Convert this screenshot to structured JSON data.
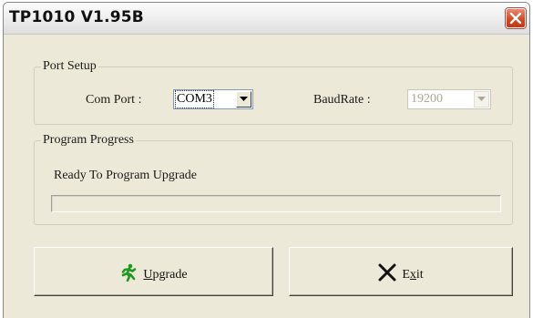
{
  "window": {
    "title": "TP1010 V1.95B"
  },
  "port_setup": {
    "legend": "Port Setup",
    "com_port_label": "Com Port :",
    "com_port_value": "COM3",
    "baud_rate_label": "BaudRate :",
    "baud_rate_value": "19200",
    "baud_rate_enabled": false
  },
  "program_progress": {
    "legend": "Program Progress",
    "status_text": "Ready To Program Upgrade",
    "progress_fraction": 0
  },
  "buttons": {
    "upgrade": {
      "accel": "U",
      "rest": "pgrade",
      "icon": "running-man-icon"
    },
    "exit": {
      "pre": "E",
      "accel": "x",
      "rest": "it",
      "icon": "x-mark-icon"
    }
  },
  "colors": {
    "dialog_bg": "#ece9d8",
    "close_button": "#d3461f",
    "upgrade_icon": "#1f9a1f"
  }
}
